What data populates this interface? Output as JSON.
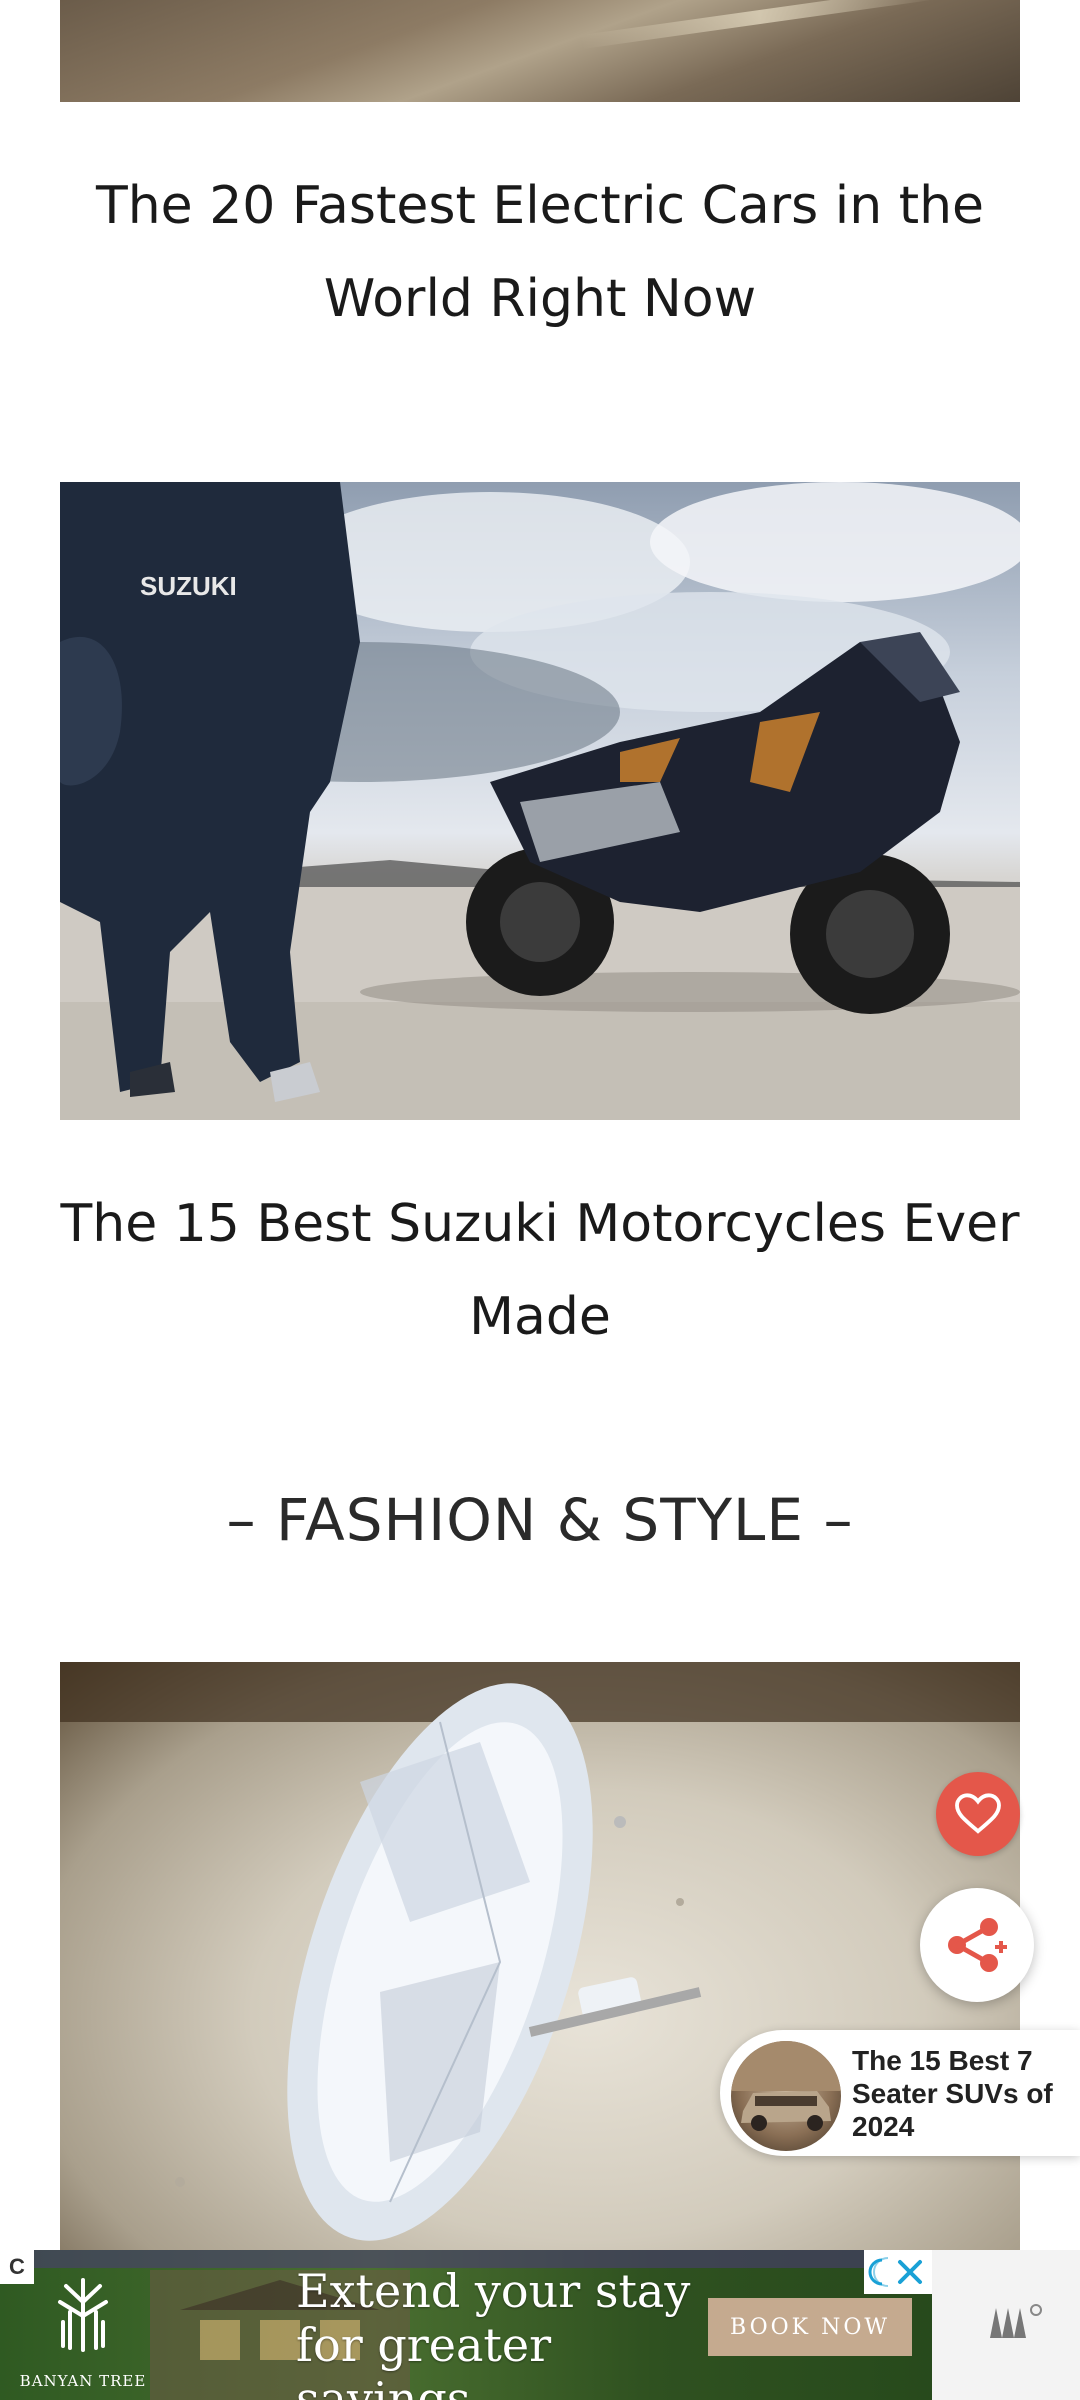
{
  "articles": [
    {
      "title": "The 20 Fastest Electric Cars in the World Right Now"
    },
    {
      "title": "The 15 Best Suzuki Motorcycles Ever Made",
      "image_text": "SUZUKI"
    }
  ],
  "section": {
    "heading": "– FASHION & STYLE –"
  },
  "floating": {
    "like_icon": "heart-icon",
    "share_icon": "share-icon"
  },
  "related": {
    "title": "The 15 Best 7 Seater SUVs of 2024"
  },
  "ad": {
    "adchoices": "C",
    "brand": "BANYAN TREE",
    "headline_line1": "Extend your stay",
    "headline_line2": "for greater savings",
    "cta": "BOOK NOW",
    "close_icon": "close-icon",
    "info_icon": "ad-info-icon"
  },
  "colors": {
    "like_button": "#e4574a",
    "share_icon": "#e4574a",
    "ad_cta": "#c5aa8f"
  }
}
